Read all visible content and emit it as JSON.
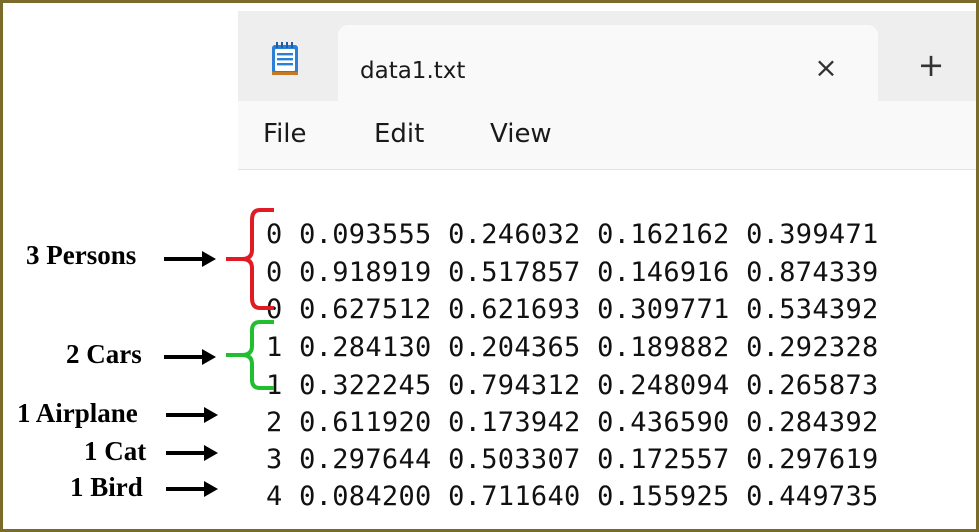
{
  "tab": {
    "title": "data1.txt",
    "close_symbol": "×",
    "new_tab_symbol": "+"
  },
  "menu": {
    "items": [
      "File",
      "Edit",
      "View"
    ]
  },
  "editor": {
    "lines": [
      "0 0.093555 0.246032 0.162162 0.399471",
      "0 0.918919 0.517857 0.146916 0.874339",
      "0 0.627512 0.621693 0.309771 0.534392",
      "1 0.284130 0.204365 0.189882 0.292328",
      "1 0.322245 0.794312 0.248094 0.265873",
      "2 0.611920 0.173942 0.436590 0.284392",
      "3 0.297644 0.503307 0.172557 0.297619",
      "4 0.084200 0.711640 0.155925 0.449735"
    ]
  },
  "annotations": {
    "persons": "3 Persons",
    "cars": "2 Cars",
    "airplane": "1 Airplane",
    "cat": "1 Cat",
    "bird": "1 Bird"
  },
  "colors": {
    "frame": "#7a6b2b",
    "persons_bracket": "#e01b24",
    "cars_bracket": "#1fbf2f",
    "app_icon": "#2b7fd4"
  },
  "icons": {
    "app": "notepad-icon",
    "close": "close-icon",
    "new_tab": "plus-icon"
  }
}
